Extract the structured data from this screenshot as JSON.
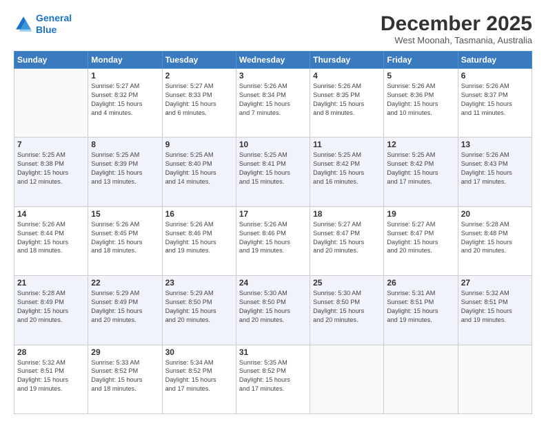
{
  "logo": {
    "line1": "General",
    "line2": "Blue"
  },
  "header": {
    "month": "December 2025",
    "location": "West Moonah, Tasmania, Australia"
  },
  "days": [
    "Sunday",
    "Monday",
    "Tuesday",
    "Wednesday",
    "Thursday",
    "Friday",
    "Saturday"
  ],
  "weeks": [
    [
      {
        "day": "",
        "content": ""
      },
      {
        "day": "1",
        "content": "Sunrise: 5:27 AM\nSunset: 8:32 PM\nDaylight: 15 hours\nand 4 minutes."
      },
      {
        "day": "2",
        "content": "Sunrise: 5:27 AM\nSunset: 8:33 PM\nDaylight: 15 hours\nand 6 minutes."
      },
      {
        "day": "3",
        "content": "Sunrise: 5:26 AM\nSunset: 8:34 PM\nDaylight: 15 hours\nand 7 minutes."
      },
      {
        "day": "4",
        "content": "Sunrise: 5:26 AM\nSunset: 8:35 PM\nDaylight: 15 hours\nand 8 minutes."
      },
      {
        "day": "5",
        "content": "Sunrise: 5:26 AM\nSunset: 8:36 PM\nDaylight: 15 hours\nand 10 minutes."
      },
      {
        "day": "6",
        "content": "Sunrise: 5:26 AM\nSunset: 8:37 PM\nDaylight: 15 hours\nand 11 minutes."
      }
    ],
    [
      {
        "day": "7",
        "content": "Sunrise: 5:25 AM\nSunset: 8:38 PM\nDaylight: 15 hours\nand 12 minutes."
      },
      {
        "day": "8",
        "content": "Sunrise: 5:25 AM\nSunset: 8:39 PM\nDaylight: 15 hours\nand 13 minutes."
      },
      {
        "day": "9",
        "content": "Sunrise: 5:25 AM\nSunset: 8:40 PM\nDaylight: 15 hours\nand 14 minutes."
      },
      {
        "day": "10",
        "content": "Sunrise: 5:25 AM\nSunset: 8:41 PM\nDaylight: 15 hours\nand 15 minutes."
      },
      {
        "day": "11",
        "content": "Sunrise: 5:25 AM\nSunset: 8:42 PM\nDaylight: 15 hours\nand 16 minutes."
      },
      {
        "day": "12",
        "content": "Sunrise: 5:25 AM\nSunset: 8:42 PM\nDaylight: 15 hours\nand 17 minutes."
      },
      {
        "day": "13",
        "content": "Sunrise: 5:26 AM\nSunset: 8:43 PM\nDaylight: 15 hours\nand 17 minutes."
      }
    ],
    [
      {
        "day": "14",
        "content": "Sunrise: 5:26 AM\nSunset: 8:44 PM\nDaylight: 15 hours\nand 18 minutes."
      },
      {
        "day": "15",
        "content": "Sunrise: 5:26 AM\nSunset: 8:45 PM\nDaylight: 15 hours\nand 18 minutes."
      },
      {
        "day": "16",
        "content": "Sunrise: 5:26 AM\nSunset: 8:46 PM\nDaylight: 15 hours\nand 19 minutes."
      },
      {
        "day": "17",
        "content": "Sunrise: 5:26 AM\nSunset: 8:46 PM\nDaylight: 15 hours\nand 19 minutes."
      },
      {
        "day": "18",
        "content": "Sunrise: 5:27 AM\nSunset: 8:47 PM\nDaylight: 15 hours\nand 20 minutes."
      },
      {
        "day": "19",
        "content": "Sunrise: 5:27 AM\nSunset: 8:47 PM\nDaylight: 15 hours\nand 20 minutes."
      },
      {
        "day": "20",
        "content": "Sunrise: 5:28 AM\nSunset: 8:48 PM\nDaylight: 15 hours\nand 20 minutes."
      }
    ],
    [
      {
        "day": "21",
        "content": "Sunrise: 5:28 AM\nSunset: 8:49 PM\nDaylight: 15 hours\nand 20 minutes."
      },
      {
        "day": "22",
        "content": "Sunrise: 5:29 AM\nSunset: 8:49 PM\nDaylight: 15 hours\nand 20 minutes."
      },
      {
        "day": "23",
        "content": "Sunrise: 5:29 AM\nSunset: 8:50 PM\nDaylight: 15 hours\nand 20 minutes."
      },
      {
        "day": "24",
        "content": "Sunrise: 5:30 AM\nSunset: 8:50 PM\nDaylight: 15 hours\nand 20 minutes."
      },
      {
        "day": "25",
        "content": "Sunrise: 5:30 AM\nSunset: 8:50 PM\nDaylight: 15 hours\nand 20 minutes."
      },
      {
        "day": "26",
        "content": "Sunrise: 5:31 AM\nSunset: 8:51 PM\nDaylight: 15 hours\nand 19 minutes."
      },
      {
        "day": "27",
        "content": "Sunrise: 5:32 AM\nSunset: 8:51 PM\nDaylight: 15 hours\nand 19 minutes."
      }
    ],
    [
      {
        "day": "28",
        "content": "Sunrise: 5:32 AM\nSunset: 8:51 PM\nDaylight: 15 hours\nand 19 minutes."
      },
      {
        "day": "29",
        "content": "Sunrise: 5:33 AM\nSunset: 8:52 PM\nDaylight: 15 hours\nand 18 minutes."
      },
      {
        "day": "30",
        "content": "Sunrise: 5:34 AM\nSunset: 8:52 PM\nDaylight: 15 hours\nand 17 minutes."
      },
      {
        "day": "31",
        "content": "Sunrise: 5:35 AM\nSunset: 8:52 PM\nDaylight: 15 hours\nand 17 minutes."
      },
      {
        "day": "",
        "content": ""
      },
      {
        "day": "",
        "content": ""
      },
      {
        "day": "",
        "content": ""
      }
    ]
  ]
}
